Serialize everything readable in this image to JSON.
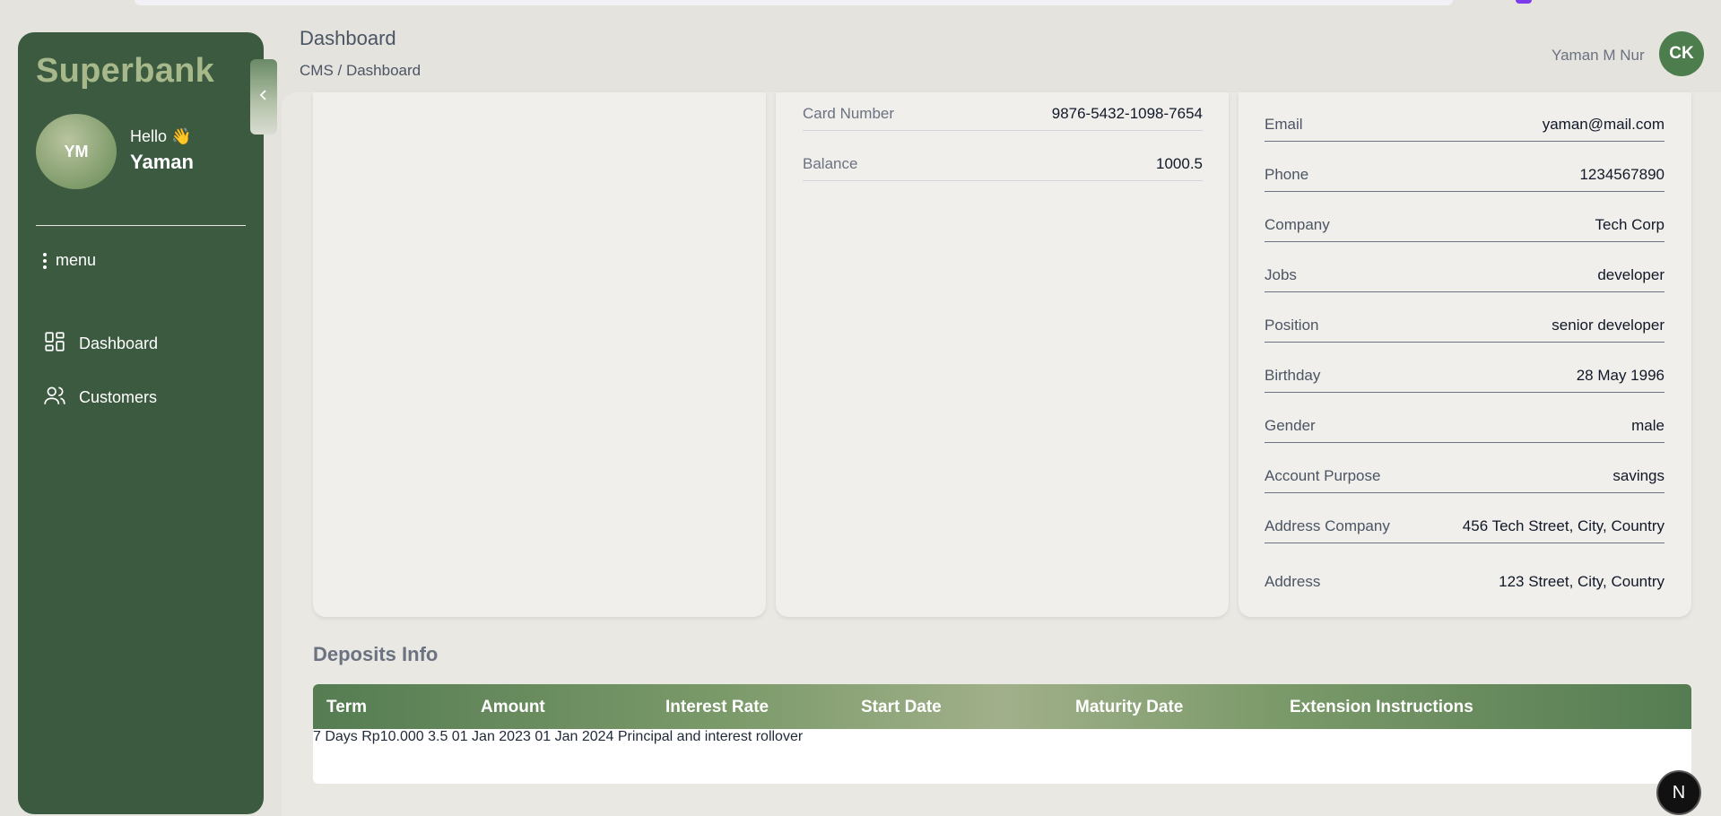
{
  "sidebar": {
    "brand": "Superbank",
    "avatar_initials": "YM",
    "greeting": "Hello 👋",
    "user_first_name": "Yaman",
    "menu_label": "menu",
    "items": [
      {
        "label": "Dashboard",
        "icon": "dashboard-grid-icon"
      },
      {
        "label": "Customers",
        "icon": "users-icon"
      }
    ]
  },
  "header": {
    "title": "Dashboard",
    "breadcrumb": "CMS / Dashboard",
    "user_name": "Yaman M Nur",
    "user_initials": "CK"
  },
  "account_card": {
    "rows": [
      {
        "label": "Card Number",
        "value": "9876-5432-1098-7654"
      },
      {
        "label": "Balance",
        "value": "1000.5"
      }
    ]
  },
  "profile_card": {
    "rows": [
      {
        "label": "Email",
        "value": "yaman@mail.com"
      },
      {
        "label": "Phone",
        "value": "1234567890"
      },
      {
        "label": "Company",
        "value": "Tech Corp"
      },
      {
        "label": "Jobs",
        "value": "developer"
      },
      {
        "label": "Position",
        "value": "senior developer"
      },
      {
        "label": "Birthday",
        "value": "28 May 1996"
      },
      {
        "label": "Gender",
        "value": "male"
      },
      {
        "label": "Account Purpose",
        "value": "savings"
      },
      {
        "label": "Address Company",
        "value": "456 Tech Street, City, Country"
      },
      {
        "label": "Address",
        "value": "123 Street, City, Country"
      }
    ]
  },
  "deposits": {
    "title": "Deposits Info",
    "columns": [
      "Term",
      "Amount",
      "Interest Rate",
      "Start Date",
      "Maturity Date",
      "Extension Instructions"
    ],
    "rows": [
      [
        "7 Days",
        "Rp10.000",
        "3.5",
        "01 Jan 2023",
        "01 Jan 2024",
        "Principal and interest rollover"
      ]
    ]
  },
  "badge": "N",
  "colors": {
    "sidebar_bg": "#3b5a40",
    "brand_text": "#a7b98a",
    "table_header": "#557c52",
    "avatar_top": "#4d7c4d"
  }
}
